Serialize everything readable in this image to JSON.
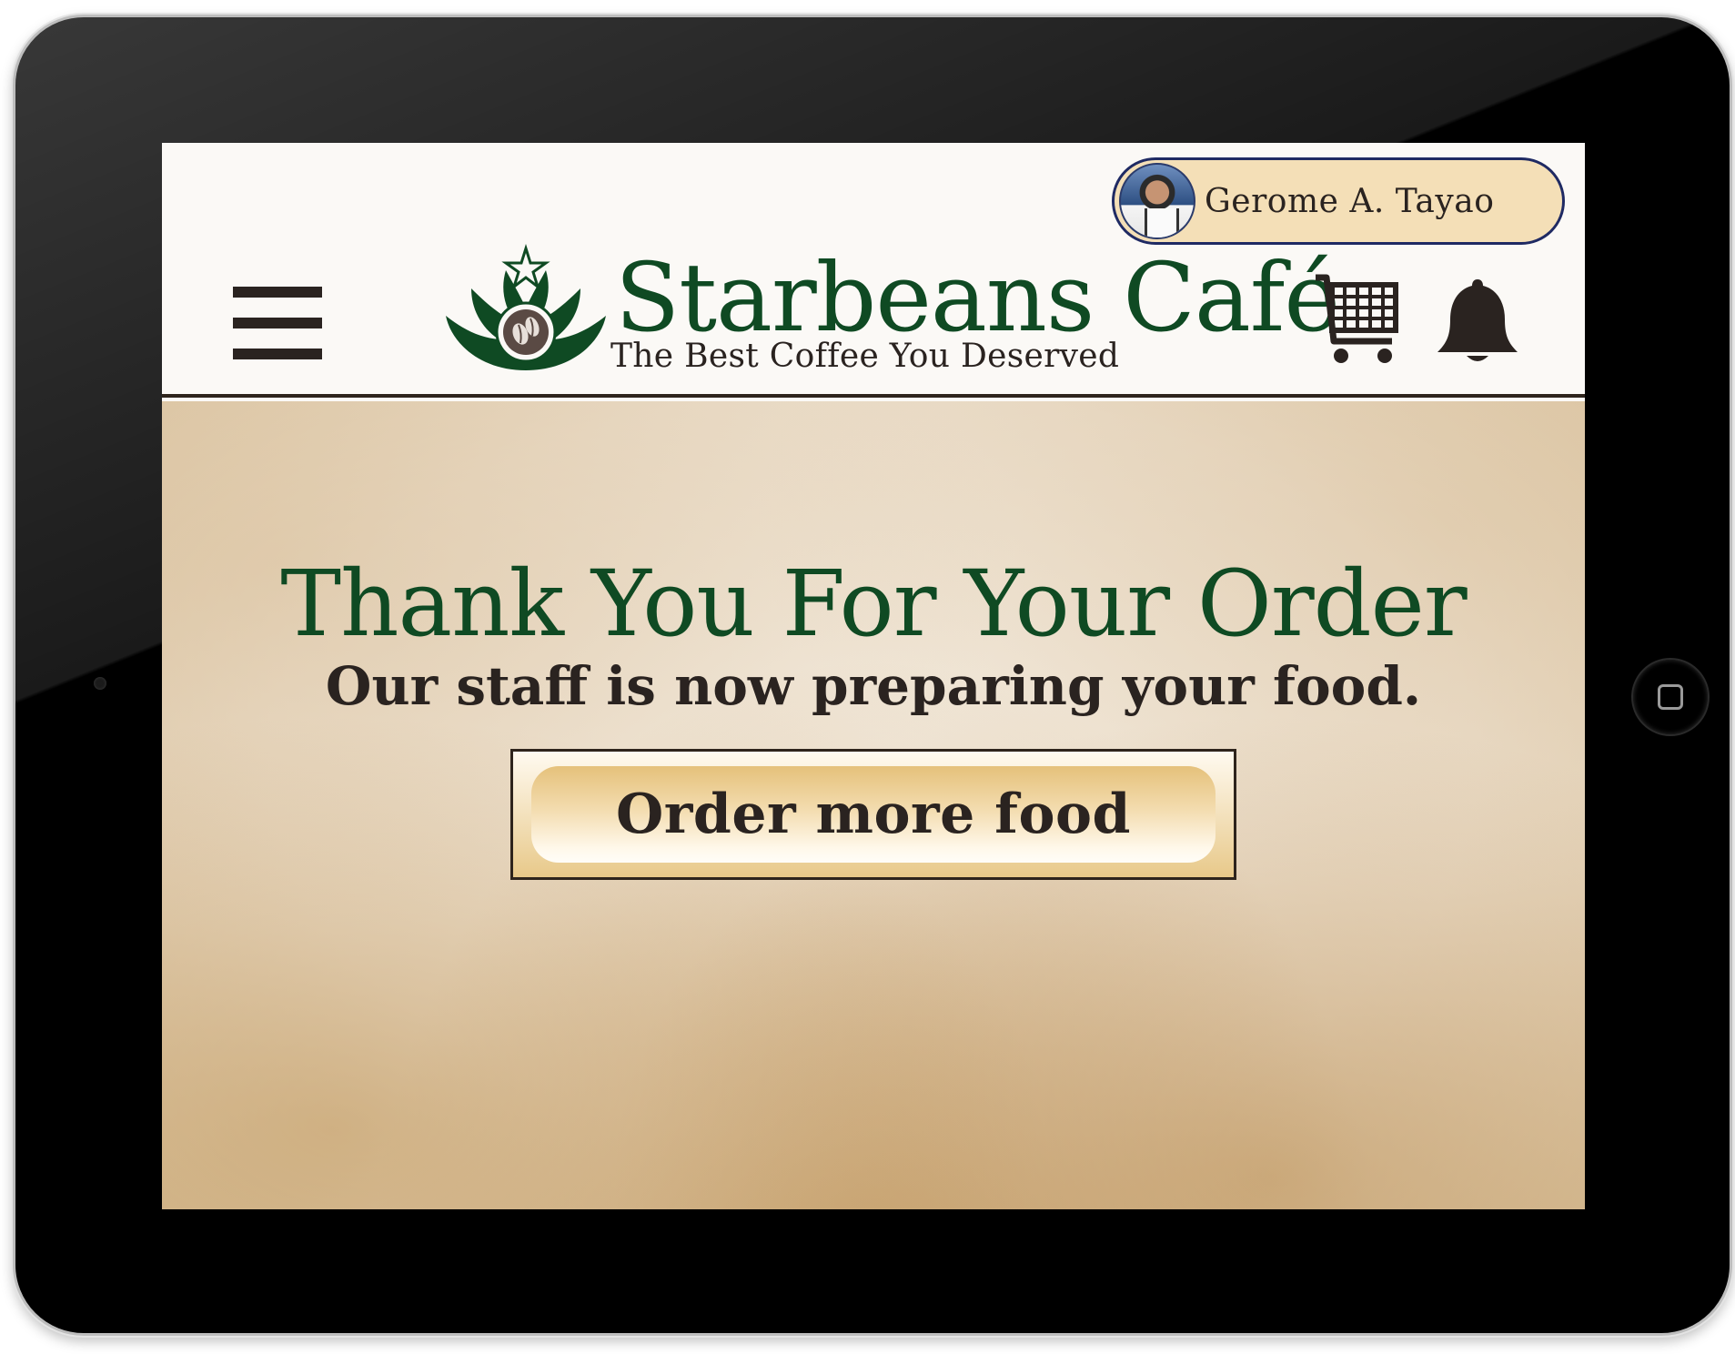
{
  "user": {
    "name": "Gerome A. Tayao"
  },
  "brand": {
    "name": "Starbeans Café",
    "tagline": "The Best Coffee You Deserved"
  },
  "icons": {
    "menu": "hamburger-menu-icon",
    "cart": "shopping-cart-icon",
    "bell": "notification-bell-icon",
    "logo": "starbeans-logo-emblem"
  },
  "confirmation": {
    "heading": "Thank You For Your Order",
    "message": "Our staff is now preparing your food.",
    "button_label": "Order more food"
  },
  "colors": {
    "brand_green": "#0f4a23",
    "text_dark": "#2a2320",
    "pill_background": "#f4dfb7",
    "pill_border": "#1f2a63",
    "button_gold": "#e5c17b"
  }
}
